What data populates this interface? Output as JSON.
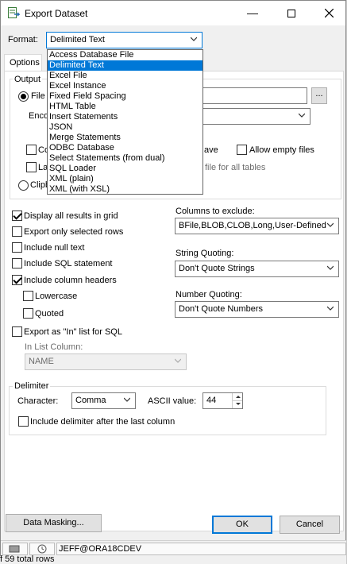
{
  "window": {
    "title": "Export Dataset"
  },
  "format": {
    "label": "Format:",
    "selected": "Delimited Text",
    "options": [
      "Access Database File",
      "Delimited Text",
      "Excel File",
      "Excel Instance",
      "Fixed Field Spacing",
      "HTML Table",
      "Insert Statements",
      "JSON",
      "Merge Statements",
      "ODBC Database",
      "Select Statements (from dual)",
      "SQL Loader",
      "XML (plain)",
      "XML (with XSL)"
    ]
  },
  "tabs": {
    "options": "Options"
  },
  "output": {
    "group_label": "Output",
    "file_label": "File",
    "encoding_label": "Enco",
    "browse_label": "...",
    "co_label": "Co",
    "la_label": "La",
    "clipboard_label": "Clipb",
    "save_label": "ave",
    "allow_empty_label": "Allow empty files",
    "file_all_tables_label": "file for all tables"
  },
  "options": {
    "display_grid": "Display all results in grid",
    "export_selected": "Export only selected rows",
    "include_null": "Include null text",
    "include_sql": "Include SQL statement",
    "include_headers": "Include column headers",
    "lowercase": "Lowercase",
    "quoted": "Quoted",
    "export_in_list": "Export as \"In\" list for SQL",
    "in_list_column_label": "In List Column:",
    "in_list_column_value": "NAME"
  },
  "exclude": {
    "label": "Columns to exclude:",
    "value": "BFile,BLOB,CLOB,Long,User-Defined"
  },
  "string_quoting": {
    "label": "String Quoting:",
    "value": "Don't Quote Strings"
  },
  "number_quoting": {
    "label": "Number Quoting:",
    "value": "Don't Quote Numbers"
  },
  "delimiter": {
    "group_label": "Delimiter",
    "character_label": "Character:",
    "character_value": "Comma",
    "ascii_label": "ASCII value:",
    "ascii_value": "44",
    "after_last_label": "Include delimiter after the last column"
  },
  "buttons": {
    "data_masking": "Data Masking...",
    "ok": "OK",
    "cancel": "Cancel"
  },
  "status": {
    "connection": "JEFF@ORA18CDEV",
    "rows": "f 59 total rows"
  },
  "colors": {
    "accent": "#0078d7",
    "selection": "#0078d7",
    "panel": "#ffffff",
    "chrome": "#f0f0f0"
  }
}
